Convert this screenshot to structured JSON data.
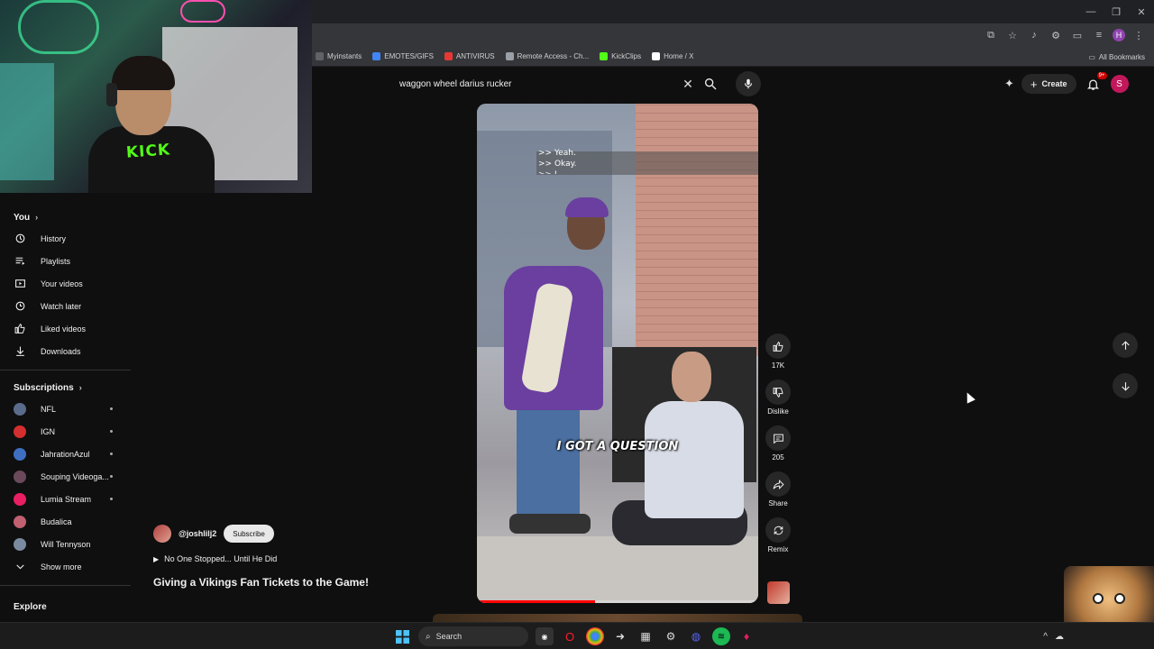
{
  "browser": {
    "bookmarks": [
      {
        "label": "Myinstants",
        "color": "#5f6368"
      },
      {
        "label": "EMOTES/GIFS",
        "color": "#4285f4"
      },
      {
        "label": "ANTIVIRUS",
        "color": "#e53935"
      },
      {
        "label": "Remote Access - Ch...",
        "color": "#9aa0a6"
      },
      {
        "label": "KickClips",
        "color": "#53fc18"
      },
      {
        "label": "Home / X",
        "color": "#ffffff"
      }
    ],
    "all_bookmarks": "All Bookmarks",
    "profile_initial": "H"
  },
  "webcam": {
    "shirt_text": "KICK"
  },
  "sidebar": {
    "you_label": "You",
    "you_items": [
      {
        "label": "History",
        "icon": "history-icon"
      },
      {
        "label": "Playlists",
        "icon": "playlists-icon"
      },
      {
        "label": "Your videos",
        "icon": "your-videos-icon"
      },
      {
        "label": "Watch later",
        "icon": "watch-later-icon"
      },
      {
        "label": "Liked videos",
        "icon": "like-icon"
      },
      {
        "label": "Downloads",
        "icon": "download-icon"
      }
    ],
    "subscriptions_label": "Subscriptions",
    "subscriptions": [
      {
        "label": "NFL",
        "color": "#5b6b8c"
      },
      {
        "label": "IGN",
        "color": "#d32f2f"
      },
      {
        "label": "JahrationAzul",
        "color": "#3f6fc0"
      },
      {
        "label": "Souping Videoga...",
        "color": "#6a4a5a"
      },
      {
        "label": "Lumia Stream",
        "color": "#e91e63"
      },
      {
        "label": "Budalica",
        "color": "#c06070"
      },
      {
        "label": "Will Tennyson",
        "color": "#7a8aa0"
      }
    ],
    "show_more": "Show more",
    "explore": "Explore"
  },
  "search": {
    "query": "waggon wheel darius rucker"
  },
  "header": {
    "create_label": "Create",
    "notif_badge": "9+",
    "account_initial": "S"
  },
  "video": {
    "caption_lines": [
      ">> Yeah.",
      ">> Okay."
    ],
    "caption_fragment": ">> I",
    "subtitle": "I GOT A QUESTION",
    "progress": 0.42
  },
  "actions": {
    "likes": "17K",
    "dislike": "Dislike",
    "comments": "205",
    "share": "Share",
    "remix": "Remix"
  },
  "overlay": {
    "channel": "@joshlilj2",
    "subscribe": "Subscribe",
    "sound": "No One Stopped... Until He Did",
    "title": "Giving a Vikings Fan Tickets to the Game!"
  },
  "taskbar": {
    "search_label": "Search"
  },
  "colors": {
    "accent_red": "#ff0000",
    "kick_green": "#53fc18",
    "bg": "#0f0f0f"
  }
}
